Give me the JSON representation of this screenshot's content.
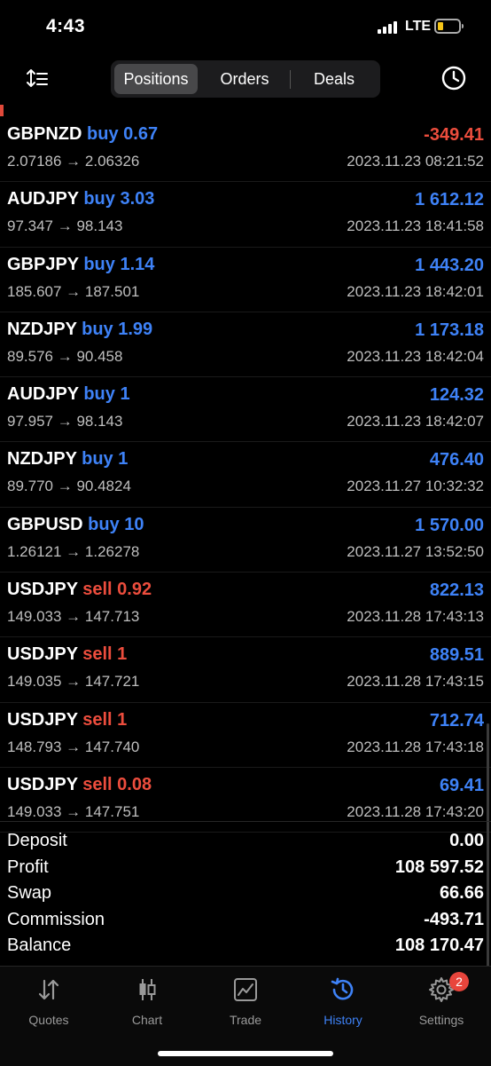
{
  "status_bar": {
    "time": "4:43",
    "network": "LTE"
  },
  "header": {
    "tabs": [
      {
        "label": "Positions",
        "active": true
      },
      {
        "label": "Orders",
        "active": false
      },
      {
        "label": "Deals",
        "active": false
      }
    ]
  },
  "trades": [
    {
      "symbol": "GBPNZD",
      "side": "buy",
      "volume": "0.67",
      "prices": "2.07186 → 2.06326",
      "profit": "-349.41",
      "date": "2023.11.23 08:21:52"
    },
    {
      "symbol": "AUDJPY",
      "side": "buy",
      "volume": "3.03",
      "prices": "97.347 → 98.143",
      "profit": "1 612.12",
      "date": "2023.11.23 18:41:58"
    },
    {
      "symbol": "GBPJPY",
      "side": "buy",
      "volume": "1.14",
      "prices": "185.607 → 187.501",
      "profit": "1 443.20",
      "date": "2023.11.23 18:42:01"
    },
    {
      "symbol": "NZDJPY",
      "side": "buy",
      "volume": "1.99",
      "prices": "89.576 → 90.458",
      "profit": "1 173.18",
      "date": "2023.11.23 18:42:04"
    },
    {
      "symbol": "AUDJPY",
      "side": "buy",
      "volume": "1",
      "prices": "97.957 → 98.143",
      "profit": "124.32",
      "date": "2023.11.23 18:42:07"
    },
    {
      "symbol": "NZDJPY",
      "side": "buy",
      "volume": "1",
      "prices": "89.770 → 90.4824",
      "profit": "476.40",
      "date": "2023.11.27 10:32:32"
    },
    {
      "symbol": "GBPUSD",
      "side": "buy",
      "volume": "10",
      "prices": "1.26121 → 1.26278",
      "profit": "1 570.00",
      "date": "2023.11.27 13:52:50"
    },
    {
      "symbol": "USDJPY",
      "side": "sell",
      "volume": "0.92",
      "prices": "149.033 → 147.713",
      "profit": "822.13",
      "date": "2023.11.28 17:43:13"
    },
    {
      "symbol": "USDJPY",
      "side": "sell",
      "volume": "1",
      "prices": "149.035 → 147.721",
      "profit": "889.51",
      "date": "2023.11.28 17:43:15"
    },
    {
      "symbol": "USDJPY",
      "side": "sell",
      "volume": "1",
      "prices": "148.793 → 147.740",
      "profit": "712.74",
      "date": "2023.11.28 17:43:18"
    },
    {
      "symbol": "USDJPY",
      "side": "sell",
      "volume": "0.08",
      "prices": "149.033 → 147.751",
      "profit": "69.41",
      "date": "2023.11.28 17:43:20"
    }
  ],
  "summary": {
    "deposit_label": "Deposit",
    "deposit": "0.00",
    "profit_label": "Profit",
    "profit": "108 597.52",
    "swap_label": "Swap",
    "swap": "66.66",
    "commission_label": "Commission",
    "commission": "-493.71",
    "balance_label": "Balance",
    "balance": "108 170.47"
  },
  "tabbar": {
    "quotes": "Quotes",
    "chart": "Chart",
    "trade": "Trade",
    "history": "History",
    "settings": "Settings",
    "settings_badge": "2"
  },
  "colors": {
    "buy": "#3e82f7",
    "sell": "#ec4d3d",
    "active_tab": "#3e82f7"
  }
}
